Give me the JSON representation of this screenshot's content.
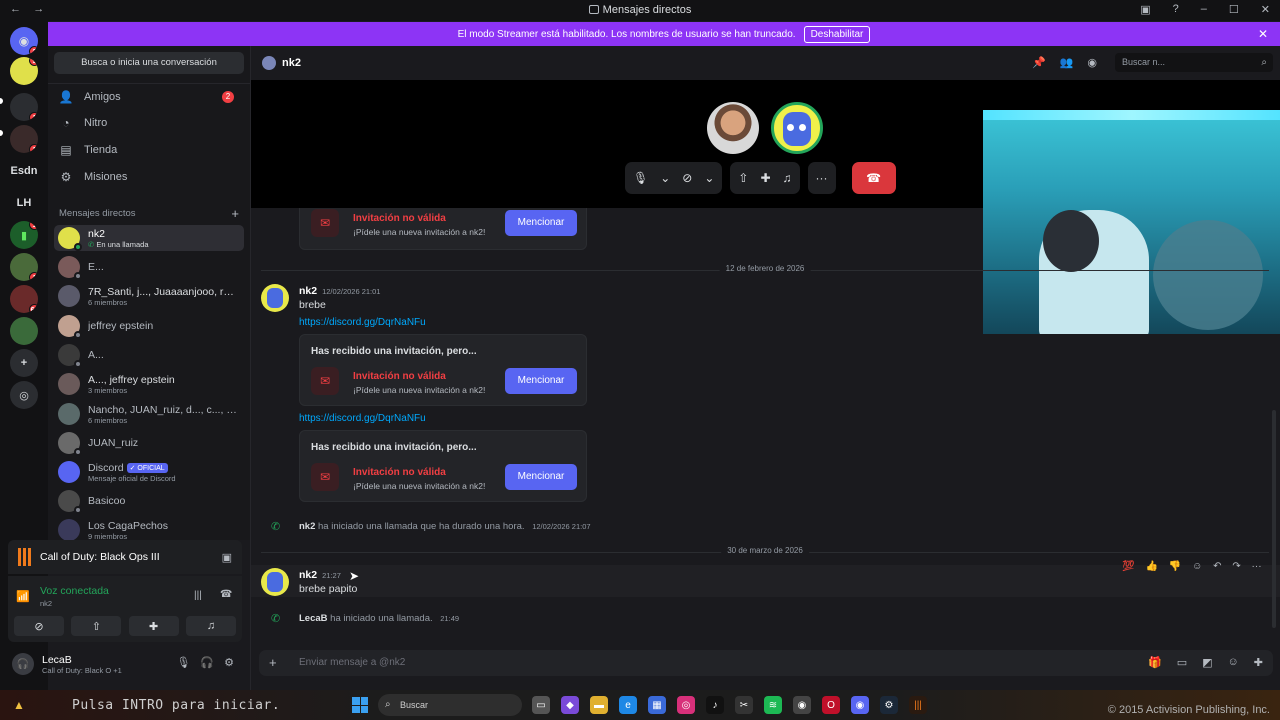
{
  "titlebar": {
    "title": "Mensajes directos",
    "back": "←",
    "forward": "→"
  },
  "banner": {
    "text": "El modo Streamer está habilitado. Los nombres de usuario se han truncado.",
    "button": "Deshabilitar"
  },
  "rail": {
    "servers": [
      {
        "label": "",
        "badge": "2"
      },
      {
        "label": "",
        "badge": "9"
      },
      {
        "label": "",
        "badge": "1"
      },
      {
        "label": "",
        "badge": "1"
      },
      {
        "label": "Esdn",
        "badge": ""
      },
      {
        "label": "LH",
        "badge": ""
      },
      {
        "label": "",
        "badge": "1"
      },
      {
        "label": "",
        "badge": "1"
      },
      {
        "label": "",
        "badge": "66"
      },
      {
        "label": "",
        "badge": ""
      }
    ]
  },
  "sidebar": {
    "search_placeholder": "Busca o inicia una conversación",
    "nav": [
      {
        "label": "Amigos",
        "badge": "2"
      },
      {
        "label": "Nitro",
        "badge": ""
      },
      {
        "label": "Tienda",
        "badge": ""
      },
      {
        "label": "Misiones",
        "badge": ""
      }
    ],
    "dm_header": "Mensajes directos",
    "dms": [
      {
        "name": "nk2",
        "sub": "En una llamada"
      },
      {
        "name": "E...",
        "sub": ""
      },
      {
        "name": "7R_Santi, j..., Juaaaanjooo, renk...",
        "sub": "6 miembros"
      },
      {
        "name": "jeffrey epstein",
        "sub": ""
      },
      {
        "name": "A...",
        "sub": ""
      },
      {
        "name": "A..., jeffrey epstein",
        "sub": "3 miembros"
      },
      {
        "name": "Nancho, JUAN_ruiz, d..., c..., E...",
        "sub": "6 miembros"
      },
      {
        "name": "JUAN_ruiz",
        "sub": ""
      },
      {
        "name": "Discord",
        "sub": "Mensaje oficial de Discord",
        "tag": "OFICIAL"
      },
      {
        "name": "Basicoo",
        "sub": ""
      },
      {
        "name": "Los CagaPechos",
        "sub": "9 miembros"
      }
    ]
  },
  "game": {
    "name": "Call of Duty: Black Ops III"
  },
  "voice": {
    "status": "Voz conectada",
    "channel": "nk2"
  },
  "user": {
    "name": "LecaB",
    "status": "Call of Duty: Black O +1"
  },
  "channel": {
    "name": "nk2",
    "search_placeholder": "Buscar n..."
  },
  "messages": {
    "invite_title": "Has recibido una invitación, pero...",
    "invalid_title": "Invitación no válida",
    "invalid_desc": "¡Pídele una nueva invitación a nk2!",
    "mention_button": "Mencionar",
    "date1": "12 de febrero de 2026",
    "date2": "30 de marzo de 2026",
    "msg1": {
      "author": "nk2",
      "time": "12/02/2026 21:01",
      "text": "brebe",
      "link": "https://discord.gg/DqrNaNFu"
    },
    "link2": "https://discord.gg/DqrNaNFu",
    "call1": {
      "author": "nk2",
      "text": "ha iniciado una llamada que ha durado una hora.",
      "time": "12/02/2026 21:07"
    },
    "msg2": {
      "author": "nk2",
      "time": "21:27",
      "text": "brebe papito"
    },
    "call2": {
      "author": "LecaB",
      "text": "ha iniciado una llamada.",
      "time": "21:49"
    }
  },
  "input": {
    "placeholder": "Enviar mensaje a @nk2"
  },
  "taskbar": {
    "intro": "Pulsa INTRO para iniciar.",
    "search": "Buscar",
    "copyright": "© 2015 Activision Publishing, Inc."
  },
  "colors": {
    "accent": "#5865f2",
    "streamer": "#8d34f5",
    "danger": "#da373c",
    "online": "#23a55a",
    "link": "#00a8fc"
  }
}
